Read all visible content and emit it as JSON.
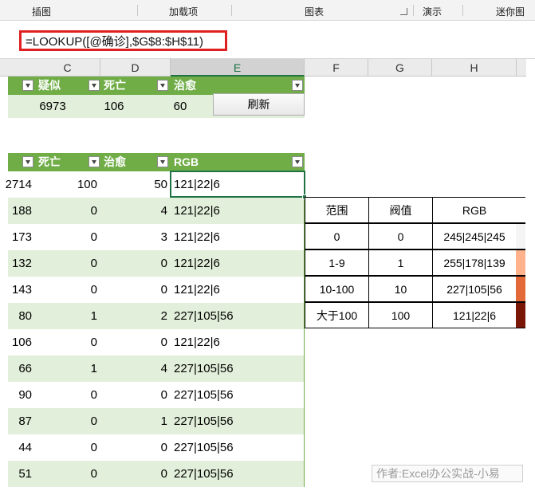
{
  "ribbon": {
    "groups": [
      "插图",
      "加载项",
      "图表",
      "演示",
      "迷你图"
    ]
  },
  "formula_bar": {
    "formula": "=LOOKUP([@确诊],$G$8:$H$11)"
  },
  "columns": [
    "C",
    "D",
    "E",
    "F",
    "G",
    "H"
  ],
  "top_table": {
    "headers": [
      "疑似",
      "死亡",
      "治愈"
    ],
    "values": [
      "6973",
      "106",
      "60"
    ],
    "refresh_label": "刷新"
  },
  "main_table": {
    "headers": [
      "死亡",
      "治愈",
      "RGB"
    ],
    "rows": [
      {
        "b": "2714",
        "c": "100",
        "d": "50",
        "e": "121|22|6"
      },
      {
        "b": "188",
        "c": "0",
        "d": "4",
        "e": "121|22|6"
      },
      {
        "b": "173",
        "c": "0",
        "d": "3",
        "e": "121|22|6"
      },
      {
        "b": "132",
        "c": "0",
        "d": "0",
        "e": "121|22|6"
      },
      {
        "b": "143",
        "c": "0",
        "d": "0",
        "e": "121|22|6"
      },
      {
        "b": "80",
        "c": "1",
        "d": "2",
        "e": "227|105|56"
      },
      {
        "b": "106",
        "c": "0",
        "d": "0",
        "e": "121|22|6"
      },
      {
        "b": "66",
        "c": "1",
        "d": "4",
        "e": "227|105|56"
      },
      {
        "b": "90",
        "c": "0",
        "d": "0",
        "e": "227|105|56"
      },
      {
        "b": "87",
        "c": "0",
        "d": "1",
        "e": "227|105|56"
      },
      {
        "b": "44",
        "c": "0",
        "d": "0",
        "e": "227|105|56"
      },
      {
        "b": "51",
        "c": "0",
        "d": "0",
        "e": "227|105|56"
      }
    ]
  },
  "range_table": {
    "headers": [
      "范围",
      "阀值",
      "RGB"
    ],
    "rows": [
      {
        "range": "0",
        "threshold": "0",
        "rgb": "245|245|245",
        "color": "#f5f5f5"
      },
      {
        "range": "1-9",
        "threshold": "1",
        "rgb": "255|178|139",
        "color": "#ffb28b"
      },
      {
        "range": "10-100",
        "threshold": "10",
        "rgb": "227|105|56",
        "color": "#e36938"
      },
      {
        "range": "大于100",
        "threshold": "100",
        "rgb": "121|22|6",
        "color": "#791606"
      }
    ]
  },
  "watermark": "作者:Excel办公实战-小易"
}
